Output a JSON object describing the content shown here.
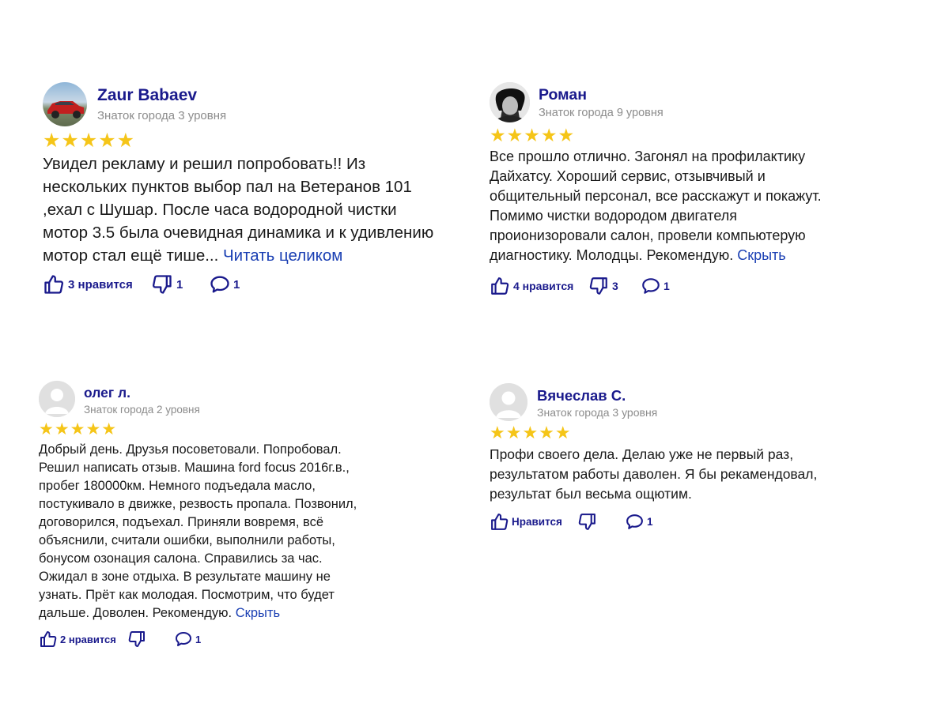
{
  "reviews": [
    {
      "name": "Zaur Babaev",
      "level": "Знаток города 3 уровня",
      "stars": "★★★★★",
      "text_lines": [
        "Увидел рекламу и решил попробовать!! Из",
        "нескольких пунктов выбор пал на Ветеранов 101",
        ",ехал с Шушар. После часа водородной чистки",
        "мотор 3.5 была очевидная динамика и к удивлению",
        "мотор стал ещё тише..."
      ],
      "link": "Читать целиком",
      "likes": "3 нравится",
      "dislikes": "1",
      "comments": "1"
    },
    {
      "name": "Роман",
      "level": "Знаток города 9 уровня",
      "stars": "★★★★★",
      "text_lines": [
        "Все прошло отлично. Загонял на профилактику",
        "Дайхатсу. Хороший сервис, отзывчивый и",
        "общительный персонал, все расскажут и покажут.",
        "Помимо чистки водородом двигателя",
        "проионизоровали салон, провели компьютерую",
        "диагностику. Молодцы. Рекомендую."
      ],
      "link": "Скрыть",
      "likes": "4 нравится",
      "dislikes": "3",
      "comments": "1"
    },
    {
      "name": "олег л.",
      "level": "Знаток города 2 уровня",
      "stars": "★★★★★",
      "text_lines": [
        "Добрый день. Друзья посоветовали. Попробовал.",
        "Решил написать отзыв. Машина ford focus 2016г.в.,",
        "пробег 180000км. Немного подъедала масло,",
        "постукивало в движке, резвость пропала. Позвонил,",
        "договорился, подъехал. Приняли вовремя, всё",
        "объяснили, считали ошибки, выполнили работы,",
        "бонусом озонация салона. Справились за час.",
        "Ожидал в зоне отдыха. В результате машину не",
        "узнать. Прёт как молодая. Посмотрим, что будет",
        "дальше. Доволен. Рекомендую."
      ],
      "link": "Скрыть",
      "likes": "2 нравится",
      "dislikes": "",
      "comments": "1"
    },
    {
      "name": "Вячеслав С.",
      "level": "Знаток города 3 уровня",
      "stars": "★★★★★",
      "text_lines": [
        "Профи своего дела. Делаю уже не первый раз,",
        "результатом работы даволен. Я бы рекамендовал,",
        "результат был весьма ощютим."
      ],
      "link": "",
      "likes": "Нравится",
      "dislikes": "",
      "comments": "1"
    }
  ],
  "icons": {
    "like": "thumbs-up-icon",
    "dislike": "thumbs-down-icon",
    "comment": "comment-icon"
  },
  "colors": {
    "name": "#1a1a8c",
    "level": "#8c8c8c",
    "star": "#f5c518",
    "link": "#1a3fb3",
    "actions": "#1a1a8c"
  }
}
